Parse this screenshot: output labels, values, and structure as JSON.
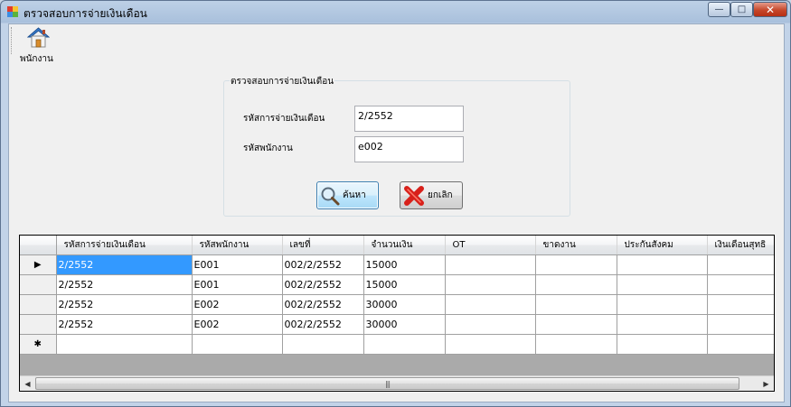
{
  "window": {
    "title": "ตรวจสอบการจ่ายเงินเดือน",
    "minimize_label": "—",
    "maximize_label": "□",
    "close_label": "✕"
  },
  "toolbar": {
    "employee_label": "พนักงาน",
    "employee_icon": "home-icon"
  },
  "form": {
    "group_title": "ตรวจสอบการจ่ายเงินเดือน",
    "payment_code_label": "รหัสการจ่ายเงินเดือน",
    "payment_code_value": "2/2552",
    "employee_code_label": "รหัสพนักงาน",
    "employee_code_value": "e002",
    "search_label": "ค้นหา",
    "cancel_label": "ยกเลิก"
  },
  "grid": {
    "columns": [
      "รหัสการจ่ายเงินเดือน",
      "รหัสพนักงาน",
      "เลขที่",
      "จำนวนเงิน",
      "OT",
      "ขาดงาน",
      "ประกันสังคม",
      "เงินเดือนสุทธิ"
    ],
    "rows": [
      {
        "indicator": "▶",
        "cells": [
          "2/2552",
          "E001",
          "002/2/2552",
          "15000",
          "",
          "",
          "",
          ""
        ]
      },
      {
        "indicator": "",
        "cells": [
          "2/2552",
          "E001",
          "002/2/2552",
          "15000",
          "",
          "",
          "",
          ""
        ]
      },
      {
        "indicator": "",
        "cells": [
          "2/2552",
          "E002",
          "002/2/2552",
          "30000",
          "",
          "",
          "",
          ""
        ]
      },
      {
        "indicator": "",
        "cells": [
          "2/2552",
          "E002",
          "002/2/2552",
          "30000",
          "",
          "",
          "",
          ""
        ]
      }
    ],
    "new_row_indicator": "✱",
    "scroll_left": "◀",
    "scroll_right": "▶",
    "scroll_grip": "|||"
  },
  "colors": {
    "selection": "#3399ff",
    "title_bar": "#a9c0dc",
    "close_button": "#c6472a"
  }
}
